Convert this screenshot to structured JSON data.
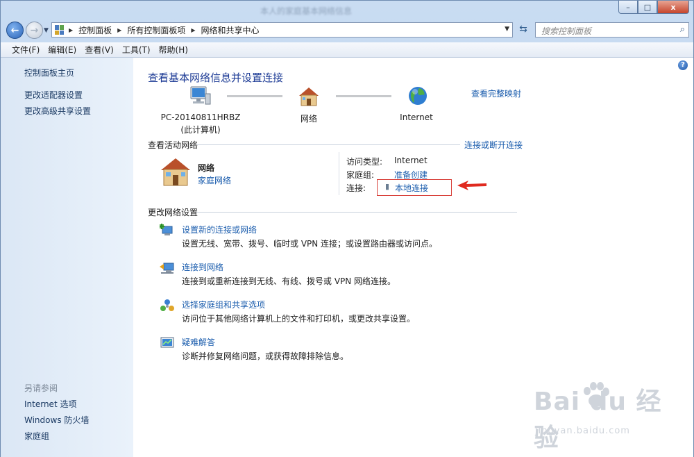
{
  "window": {
    "title": "本人的家庭基本网络信息",
    "buttons": {
      "minimize": "–",
      "maximize": "□",
      "close": "x"
    }
  },
  "address_bar": {
    "crumbs": [
      "控制面板",
      "所有控制面板项",
      "网络和共享中心"
    ],
    "search_placeholder": "搜索控制面板"
  },
  "menu": [
    "文件(F)",
    "编辑(E)",
    "查看(V)",
    "工具(T)",
    "帮助(H)"
  ],
  "sidebar": {
    "top_links": [
      "控制面板主页",
      "更改适配器设置",
      "更改高级共享设置"
    ],
    "see_also_heading": "另请参阅",
    "see_also_links": [
      "Internet 选项",
      "Windows 防火墙",
      "家庭组"
    ]
  },
  "main": {
    "title": "查看基本网络信息并设置连接",
    "full_map_link": "查看完整映射",
    "nodes": [
      {
        "label": "PC-20140811HRBZ",
        "sublabel": "(此计算机)",
        "icon": "computer-icon"
      },
      {
        "label": "网络",
        "icon": "house-icon"
      },
      {
        "label": "Internet",
        "icon": "globe-icon"
      }
    ],
    "active_networks": {
      "heading": "查看活动网络",
      "connect_link": "连接或断开连接",
      "network_name": "网络",
      "network_type": "家庭网络",
      "access_type_label": "访问类型:",
      "access_type_value": "Internet",
      "homegroup_label": "家庭组:",
      "homegroup_value": "准备创建",
      "connections_label": "连接:",
      "connections_value": "本地连接"
    },
    "change_settings": {
      "heading": "更改网络设置",
      "tasks": [
        {
          "title": "设置新的连接或网络",
          "desc": "设置无线、宽带、拨号、临时或 VPN 连接；或设置路由器或访问点。",
          "icon": "new-connection-icon"
        },
        {
          "title": "连接到网络",
          "desc": "连接到或重新连接到无线、有线、拨号或 VPN 网络连接。",
          "icon": "connect-network-icon"
        },
        {
          "title": "选择家庭组和共享选项",
          "desc": "访问位于其他网络计算机上的文件和打印机，或更改共享设置。",
          "icon": "homegroup-icon"
        },
        {
          "title": "疑难解答",
          "desc": "诊断并修复网络问题，或获得故障排除信息。",
          "icon": "troubleshoot-icon"
        }
      ]
    }
  },
  "watermark": {
    "text": "Bai  du 经验",
    "sub": "jingyan.baidu.com"
  },
  "colors": {
    "link": "#1a5cad",
    "title": "#1e3c96",
    "highlight": "#d8403a"
  }
}
